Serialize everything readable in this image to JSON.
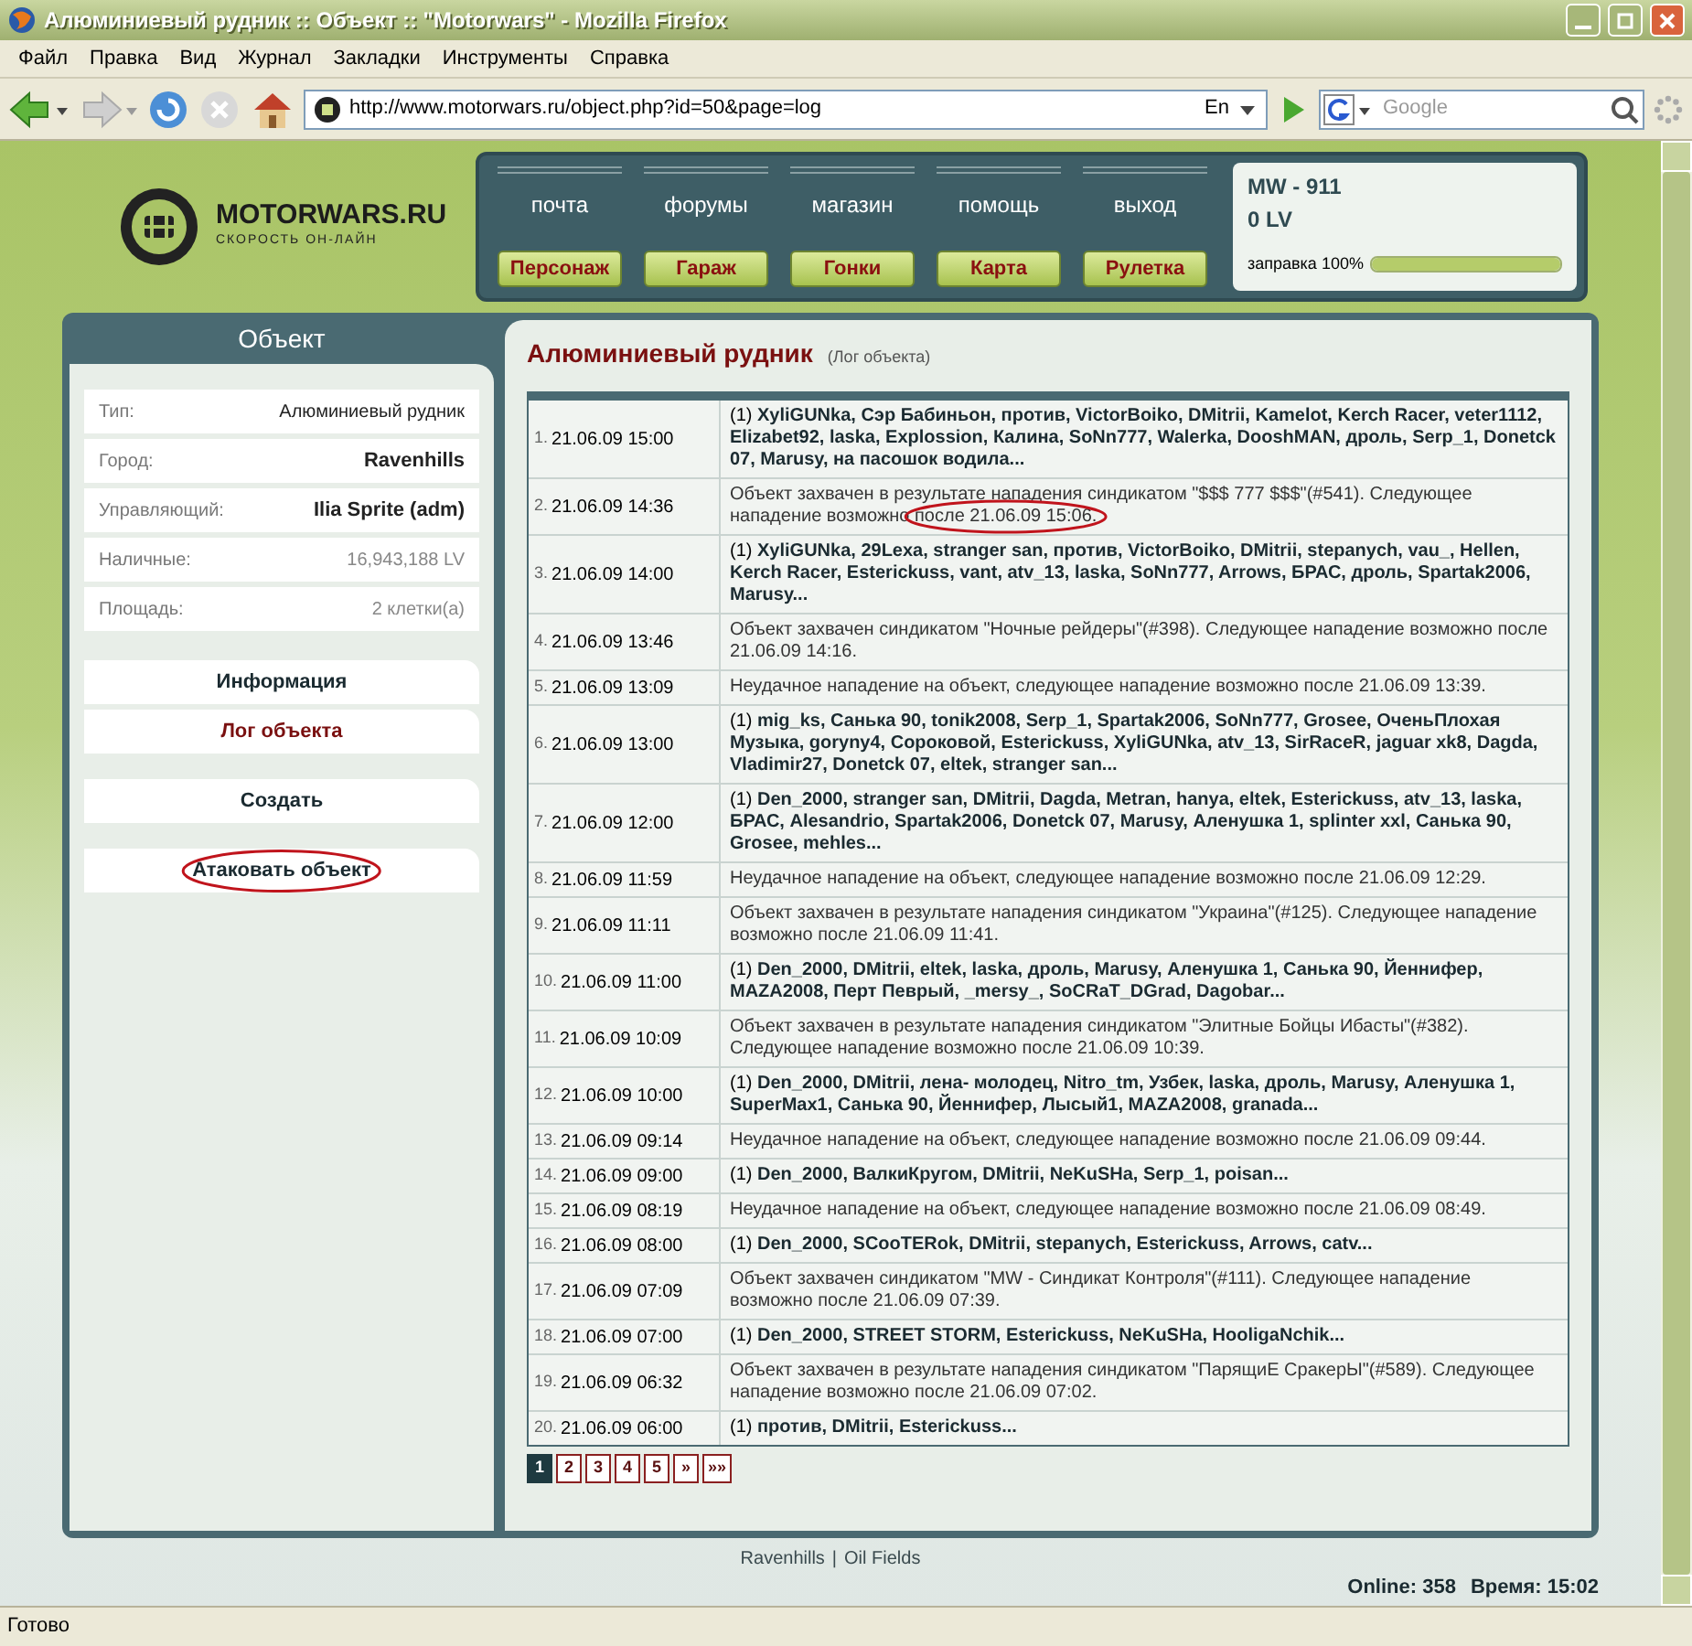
{
  "window": {
    "title": "Алюминиевый рудник :: Объект :: \"Motorwars\" - Mozilla Firefox"
  },
  "menu": [
    "Файл",
    "Правка",
    "Вид",
    "Журнал",
    "Закладки",
    "Инструменты",
    "Справка"
  ],
  "toolbar": {
    "url": "http://www.motorwars.ru/object.php?id=50&page=log",
    "language": "En",
    "search": {
      "placeholder": "Google"
    }
  },
  "header": {
    "logo": "MOTORWARS.RU",
    "tagline": "СКОРОСТЬ ОН-ЛАЙН",
    "links": [
      "почта",
      "форумы",
      "магазин",
      "помощь",
      "выход"
    ],
    "buttons": [
      "Персонаж",
      "Гараж",
      "Гонки",
      "Карта",
      "Рулетка"
    ],
    "player": {
      "name": "MW - 911",
      "money": "0 LV",
      "fuel_label": "заправка 100%",
      "level": 1
    }
  },
  "sidebar": {
    "title": "Объект",
    "info": [
      {
        "label": "Тип:",
        "value": "Алюминиевый рудник",
        "bold": false,
        "muted": false
      },
      {
        "label": "Город:",
        "value": "Ravenhills",
        "bold": true,
        "muted": false
      },
      {
        "label": "Управляющий:",
        "value": "Ilia Sprite (adm)",
        "bold": true,
        "muted": false
      },
      {
        "label": "Наличные:",
        "value": "16,943,188 LV",
        "bold": false,
        "muted": true
      },
      {
        "label": "Площадь:",
        "value": "2 клетки(а)",
        "bold": false,
        "muted": true
      }
    ],
    "menu_groups": [
      [
        {
          "label": "Информация",
          "selected": false,
          "circled": false
        },
        {
          "label": "Лог объекта",
          "selected": true,
          "circled": false
        }
      ],
      [
        {
          "label": "Создать",
          "selected": false,
          "circled": false
        }
      ],
      [
        {
          "label": "Атаковать объект",
          "selected": false,
          "circled": true
        }
      ]
    ]
  },
  "content": {
    "title": "Алюминиевый рудник",
    "subtitle": "(Лог объекта)",
    "rows": [
      {
        "num": "1.",
        "date": "21.06.09 15:00",
        "kind": "attack",
        "prefix": "(1)",
        "text": "XyliGUNka, Сэр Бабиньон, против, VictorBoiko, DMitrii, Kamelot, Kerch Racer, veter1112, Elizabet92, laska, Explossion, Калина, SoNn777, Walerka, DooshMAN, дроль, Serp_1, Donetck 07, Marusy, на пасошок водила..."
      },
      {
        "num": "2.",
        "date": "21.06.09 14:36",
        "kind": "message",
        "text": "Объект захвачен в результате нападения синдикатом \"$$$ 777 $$$\"(#541). Следующее нападение возможно ",
        "circled": "после 21.06.09 15:06."
      },
      {
        "num": "3.",
        "date": "21.06.09 14:00",
        "kind": "attack",
        "prefix": "(1)",
        "text": "XyliGUNka, 29Lexa, stranger san, против, VictorBoiko, DMitrii, stepanych, vau_, Hellen, Kerch Racer, Esterickuss, vant, atv_13, laska, SoNn777, Arrows, БРАС, дроль, Spartak2006, Marusy..."
      },
      {
        "num": "4.",
        "date": "21.06.09 13:46",
        "kind": "message",
        "text": "Объект захвачен синдикатом \"Ночные рейдеры\"(#398). Следующее нападение возможно после 21.06.09 14:16."
      },
      {
        "num": "5.",
        "date": "21.06.09 13:09",
        "kind": "message",
        "text": "Неудачное нападение на объект, следующее нападение возможно после 21.06.09 13:39."
      },
      {
        "num": "6.",
        "date": "21.06.09 13:00",
        "kind": "attack",
        "prefix": "(1)",
        "text": "mig_ks, Санька 90, tonik2008, Serp_1, Spartak2006, SoNn777, Grosee, ОченьПлохая Музыка, goryny4, Сороковой, Esterickuss, XyliGUNka, atv_13, SirRaceR, jaguar xk8, Dagda, Vladimir27, Donetck 07, eltek, stranger san..."
      },
      {
        "num": "7.",
        "date": "21.06.09 12:00",
        "kind": "attack",
        "prefix": "(1)",
        "text": "Den_2000, stranger san, DMitrii, Dagda, Metran, hanya, eltek, Esterickuss, atv_13, laska, БРАС, Alesandrio, Spartak2006, Donetck 07, Marusy, Аленушка 1, splinter xxl, Санька 90, Grosee, mehles..."
      },
      {
        "num": "8.",
        "date": "21.06.09 11:59",
        "kind": "message",
        "text": "Неудачное нападение на объект, следующее нападение возможно после 21.06.09 12:29."
      },
      {
        "num": "9.",
        "date": "21.06.09 11:11",
        "kind": "message",
        "text": "Объект захвачен в результате нападения синдикатом \"Украина\"(#125). Следующее нападение возможно после 21.06.09 11:41."
      },
      {
        "num": "10.",
        "date": "21.06.09 11:00",
        "kind": "attack",
        "prefix": "(1)",
        "text": "Den_2000, DMitrii, eltek, laska, дроль, Marusy, Аленушка 1, Санька 90, Йеннифер, MAZA2008, Перт Певрый, _mersy_, SoCRaT_DGrad, Dagobar..."
      },
      {
        "num": "11.",
        "date": "21.06.09 10:09",
        "kind": "message",
        "text": "Объект захвачен в результате нападения синдикатом \"Элитные Бойцы Ибасты\"(#382). Следующее нападение возможно после 21.06.09 10:39."
      },
      {
        "num": "12.",
        "date": "21.06.09 10:00",
        "kind": "attack",
        "prefix": "(1)",
        "text": "Den_2000, DMitrii, лена- молодец, Nitro_tm, Узбек, laska, дроль, Marusy, Аленушка 1, SuperMax1, Санька 90, Йеннифер, Лысый1, MAZA2008, granada..."
      },
      {
        "num": "13.",
        "date": "21.06.09 09:14",
        "kind": "message",
        "text": "Неудачное нападение на объект, следующее нападение возможно после 21.06.09 09:44."
      },
      {
        "num": "14.",
        "date": "21.06.09 09:00",
        "kind": "attack",
        "prefix": "(1)",
        "text": "Den_2000, ВалкиКругом, DMitrii, NeKuSHa, Serp_1, poisan..."
      },
      {
        "num": "15.",
        "date": "21.06.09 08:19",
        "kind": "message",
        "text": "Неудачное нападение на объект, следующее нападение возможно после 21.06.09 08:49."
      },
      {
        "num": "16.",
        "date": "21.06.09 08:00",
        "kind": "attack",
        "prefix": "(1)",
        "text": "Den_2000, SCooTERok, DMitrii, stepanych, Esterickuss, Arrows, catv..."
      },
      {
        "num": "17.",
        "date": "21.06.09 07:09",
        "kind": "message",
        "text": "Объект захвачен синдикатом \"MW - Синдикат Контроля\"(#111). Следующее нападение возможно после 21.06.09 07:39."
      },
      {
        "num": "18.",
        "date": "21.06.09 07:00",
        "kind": "attack",
        "prefix": "(1)",
        "text": "Den_2000, STREET STORM, Esterickuss, NeKuSHa, HooligaNchik..."
      },
      {
        "num": "19.",
        "date": "21.06.09 06:32",
        "kind": "message",
        "text": "Объект захвачен в результате нападения синдикатом \"ПарящиЕ СракерЫ\"(#589). Следующее нападение возможно после 21.06.09 07:02."
      },
      {
        "num": "20.",
        "date": "21.06.09 06:00",
        "kind": "attack",
        "prefix": "(1)",
        "text": "против, DMitrii, Esterickuss..."
      }
    ],
    "pages": [
      {
        "label": "1",
        "selected": true
      },
      {
        "label": "2",
        "selected": false
      },
      {
        "label": "3",
        "selected": false
      },
      {
        "label": "4",
        "selected": false
      },
      {
        "label": "5",
        "selected": false
      },
      {
        "label": "»",
        "selected": false
      },
      {
        "label": "»»",
        "selected": false
      }
    ]
  },
  "footer": {
    "links": [
      "Ravenhills",
      "Oil Fields"
    ],
    "separator": "|",
    "online": "Online: 358",
    "time": "Время: 15:02"
  },
  "status_bar": "Готово"
}
